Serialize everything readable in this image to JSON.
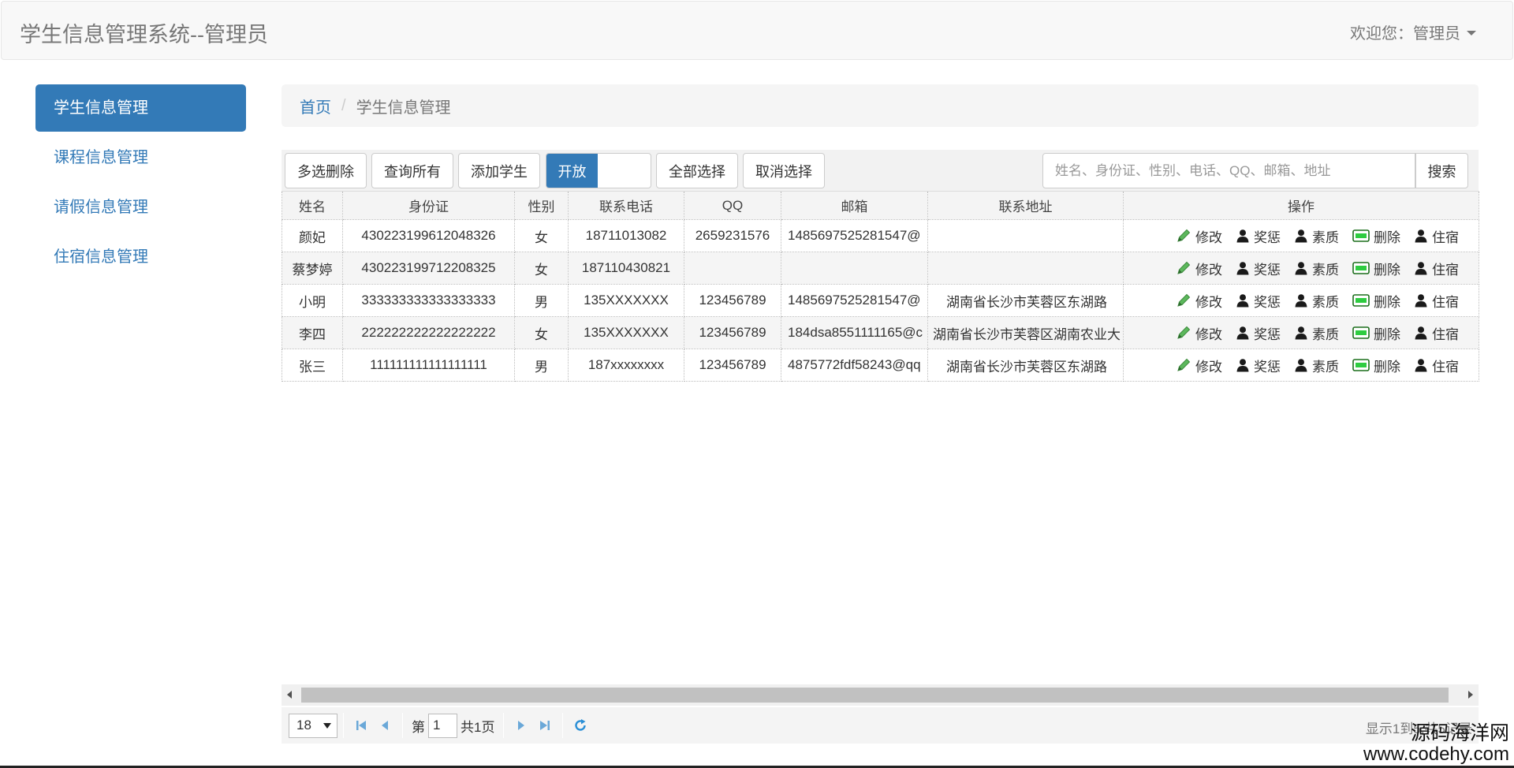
{
  "header": {
    "title": "学生信息管理系统--管理员",
    "welcome": "欢迎您：管理员"
  },
  "sidebar": {
    "items": [
      {
        "label": "学生信息管理",
        "active": true
      },
      {
        "label": "课程信息管理",
        "active": false
      },
      {
        "label": "请假信息管理",
        "active": false
      },
      {
        "label": "住宿信息管理",
        "active": false
      }
    ]
  },
  "breadcrumb": {
    "home": "首页",
    "separator": "/",
    "current": "学生信息管理"
  },
  "toolbar": {
    "multi_delete": "多选删除",
    "query_all": "查询所有",
    "add_student": "添加学生",
    "switch_label": "开放",
    "select_all": "全部选择",
    "cancel_select": "取消选择",
    "search_placeholder": "姓名、身份证、性别、电话、QQ、邮箱、地址",
    "search_button": "搜索"
  },
  "table": {
    "columns": [
      "姓名",
      "身份证",
      "性别",
      "联系电话",
      "QQ",
      "邮箱",
      "联系地址",
      "操作"
    ],
    "actions": [
      "修改",
      "奖惩",
      "素质",
      "删除",
      "住宿"
    ],
    "rows": [
      {
        "name": "颜妃",
        "id_card": "430223199612048326",
        "gender": "女",
        "phone": "18711013082",
        "qq": "2659231576",
        "email": "1485697525281547@",
        "address": ""
      },
      {
        "name": "蔡梦婷",
        "id_card": "430223199712208325",
        "gender": "女",
        "phone": "187110430821",
        "qq": "",
        "email": "",
        "address": ""
      },
      {
        "name": "小明",
        "id_card": "333333333333333333",
        "gender": "男",
        "phone": "135XXXXXXX",
        "qq": "123456789",
        "email": "1485697525281547@",
        "address": "湖南省长沙市芙蓉区东湖路"
      },
      {
        "name": "李四",
        "id_card": "222222222222222222",
        "gender": "女",
        "phone": "135XXXXXXX",
        "qq": "123456789",
        "email": "184dsa8551111165@c",
        "address": "湖南省长沙市芙蓉区湖南农业大"
      },
      {
        "name": "张三",
        "id_card": "111111111111111111",
        "gender": "男",
        "phone": "187xxxxxxxx",
        "qq": "123456789",
        "email": "4875772fdf58243@qq",
        "address": "湖南省长沙市芙蓉区东湖路"
      }
    ]
  },
  "pagination": {
    "page_size": "18",
    "page_prefix": "第",
    "current_page": "1",
    "total_pages": "共1页",
    "info": "显示1到5,共5记录"
  },
  "watermark": {
    "name": "源码海洋网",
    "url": "www.codehy.com"
  },
  "colors": {
    "primary": "#337ab7",
    "edit_icon": "#5cb85c",
    "delete_icon": "#2e9e2e"
  },
  "icons": {
    "edit": "pencil-icon",
    "reward": "user-icon",
    "quality": "user-icon",
    "delete": "minus-box-icon",
    "dorm": "user-icon"
  }
}
